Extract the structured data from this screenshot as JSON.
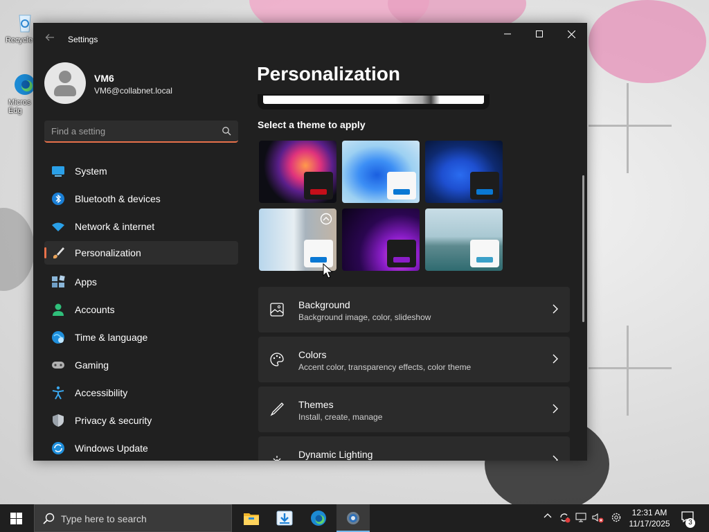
{
  "desktop": {
    "icons": [
      {
        "label": "Recycle",
        "icon": "recycle-bin-icon"
      },
      {
        "label": "Micros Edg",
        "icon": "edge-shortcut-icon"
      }
    ]
  },
  "window": {
    "title": "Settings",
    "controls": [
      "minimize-icon",
      "maximize-icon",
      "close-icon"
    ]
  },
  "profile": {
    "name": "VM6",
    "email": "VM6@collabnet.local"
  },
  "search": {
    "placeholder": "Find a setting"
  },
  "nav": {
    "items": [
      {
        "label": "System",
        "icon": "system-icon",
        "active": false
      },
      {
        "label": "Bluetooth & devices",
        "icon": "bluetooth-icon",
        "active": false
      },
      {
        "label": "Network & internet",
        "icon": "wifi-icon",
        "active": false
      },
      {
        "label": "Personalization",
        "icon": "brush-icon",
        "active": true
      },
      {
        "label": "Apps",
        "icon": "apps-icon",
        "active": false
      },
      {
        "label": "Accounts",
        "icon": "accounts-icon",
        "active": false
      },
      {
        "label": "Time & language",
        "icon": "globe-icon",
        "active": false
      },
      {
        "label": "Gaming",
        "icon": "gamepad-icon",
        "active": false
      },
      {
        "label": "Accessibility",
        "icon": "accessibility-icon",
        "active": false
      },
      {
        "label": "Privacy & security",
        "icon": "shield-icon",
        "active": false
      },
      {
        "label": "Windows Update",
        "icon": "update-icon",
        "active": false
      }
    ]
  },
  "content": {
    "title": "Personalization",
    "theme_section_label": "Select a theme to apply",
    "themes": [
      {
        "name": "glow",
        "accent": "#c40f1a"
      },
      {
        "name": "windows-light",
        "accent": "#0a78d4"
      },
      {
        "name": "windows-dark",
        "accent": "#0a78d4"
      },
      {
        "name": "windows-spotlight",
        "accent": "#0a78d4"
      },
      {
        "name": "captured-motion",
        "accent": "#8a1dc8"
      },
      {
        "name": "flow",
        "accent": "#3aa0c8"
      }
    ],
    "cards": [
      {
        "title": "Background",
        "subtitle": "Background image, color, slideshow",
        "icon": "picture-icon"
      },
      {
        "title": "Colors",
        "subtitle": "Accent color, transparency effects, color theme",
        "icon": "palette-icon"
      },
      {
        "title": "Themes",
        "subtitle": "Install, create, manage",
        "icon": "pen-icon"
      },
      {
        "title": "Dynamic Lighting",
        "subtitle": "",
        "icon": "lighting-icon"
      }
    ]
  },
  "taskbar": {
    "search_placeholder": "Type here to search",
    "apps": [
      "file-explorer-icon",
      "downloads-icon",
      "edge-icon",
      "settings-icon"
    ],
    "tray": [
      "chevron-up-icon",
      "sync-icon",
      "network-icon",
      "volume-muted-icon",
      "gear-icon"
    ],
    "time": "12:31 AM",
    "date": "11/17/2025",
    "notifications": "3"
  },
  "colors": {
    "accent": "#e8714a",
    "window_bg": "#202020",
    "card_bg": "#2b2b2b"
  }
}
